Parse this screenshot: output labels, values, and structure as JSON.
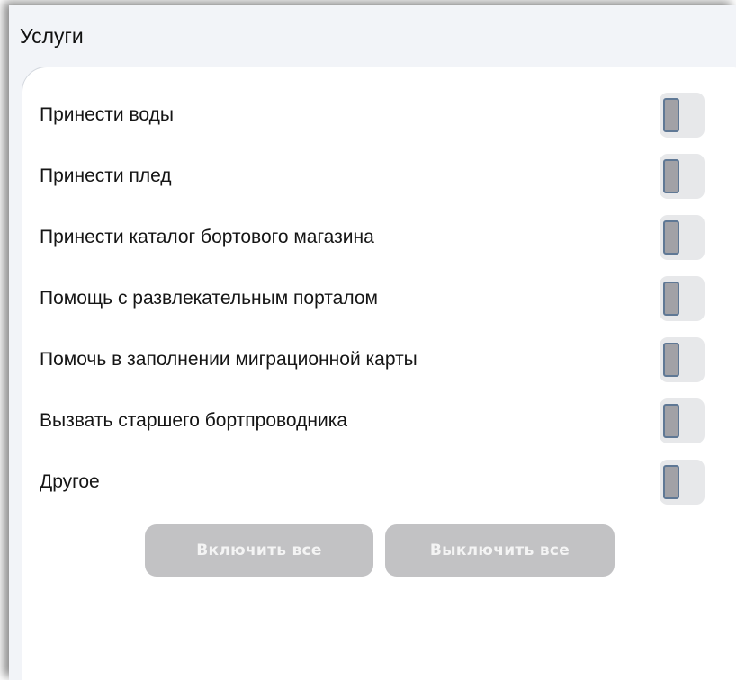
{
  "title": "Услуги",
  "services": [
    {
      "label": "Принести воды",
      "enabled": false
    },
    {
      "label": "Принести плед",
      "enabled": false
    },
    {
      "label": "Принести каталог бортового магазина",
      "enabled": false
    },
    {
      "label": "Помощь с развлекательным порталом",
      "enabled": false
    },
    {
      "label": "Помочь в заполнении миграционной карты",
      "enabled": false
    },
    {
      "label": "Вызвать старшего бортпроводника",
      "enabled": false
    },
    {
      "label": "Другое",
      "enabled": false
    }
  ],
  "buttons": {
    "enable_all": "Включить все",
    "disable_all": "Выключить все"
  },
  "colors": {
    "window_bg": "#f2f4f8",
    "panel_bg": "#ffffff",
    "toggle_track": "#e7e8ea",
    "toggle_knob": "#a1a1a6",
    "toggle_knob_border": "#5f7895",
    "button_bg": "#c2c2c4",
    "button_text": "#f4f4f4"
  }
}
